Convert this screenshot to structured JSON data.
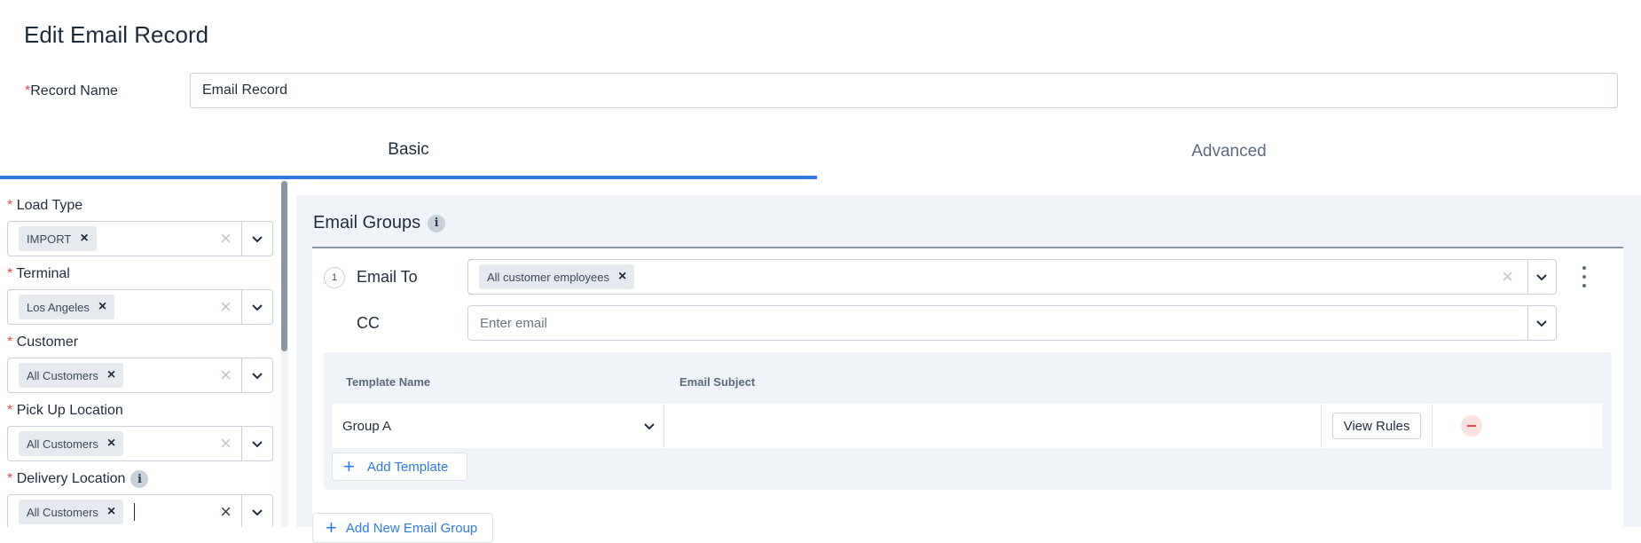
{
  "page": {
    "title": "Edit Email Record"
  },
  "record": {
    "label": "Record Name",
    "required_mark": "*",
    "value": "Email Record"
  },
  "tabs": [
    {
      "label": "Basic",
      "active": true
    },
    {
      "label": "Advanced",
      "active": false
    }
  ],
  "left_fields": [
    {
      "label": "Load Type",
      "chip": "IMPORT"
    },
    {
      "label": "Terminal",
      "chip": "Los Angeles"
    },
    {
      "label": "Customer",
      "chip": "All Customers"
    },
    {
      "label": "Pick Up Location",
      "chip": "All Customers"
    },
    {
      "label": "Delivery Location",
      "chip": "All Customers",
      "info_icon": "i"
    }
  ],
  "email_groups": {
    "title": "Email Groups",
    "info_icon": "i",
    "groups": [
      {
        "number": "1",
        "to_label": "Email To",
        "to_chip": "All customer employees",
        "cc_label": "CC",
        "cc_placeholder": "Enter email",
        "templates": {
          "headers": {
            "name": "Template Name",
            "subject": "Email Subject"
          },
          "rows": [
            {
              "name": "Group A",
              "subject": "",
              "view_rules": "View Rules"
            }
          ],
          "add_label": "Add Template"
        }
      }
    ],
    "add_group_label": "Add New Email Group"
  },
  "colors": {
    "accent": "#2f7ae5",
    "required": "#e5484d",
    "panel_bg": "#f0f3f7"
  },
  "icons": [
    "chip-remove-icon",
    "clear-icon",
    "chevron-down-icon",
    "info-icon",
    "kebab-menu-icon",
    "remove-icon",
    "plus-icon"
  ]
}
